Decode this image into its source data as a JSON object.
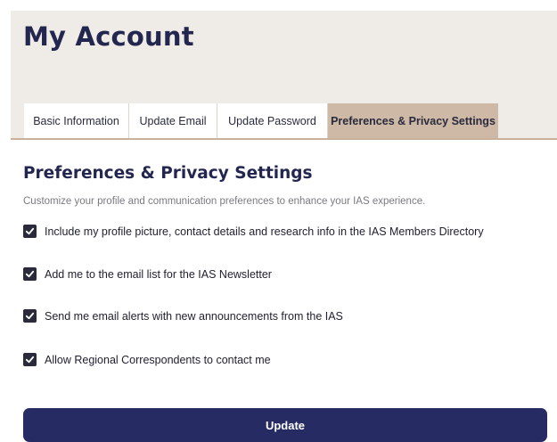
{
  "page": {
    "title": "My Account"
  },
  "tabs": [
    {
      "label": "Basic Information",
      "active": false
    },
    {
      "label": "Update Email",
      "active": false
    },
    {
      "label": "Update Password",
      "active": false
    },
    {
      "label": "Preferences & Privacy Settings",
      "active": true
    }
  ],
  "section": {
    "title": "Preferences & Privacy Settings",
    "description": "Customize your profile and communication preferences to enhance your IAS experience."
  },
  "options": [
    {
      "label": "Include my profile picture, contact details and research info in the IAS Members Directory",
      "checked": true
    },
    {
      "label": "Add me to the email list for the IAS Newsletter",
      "checked": true
    },
    {
      "label": "Send me email alerts with new announcements from the IAS",
      "checked": true
    },
    {
      "label": "Allow Regional Correspondents to contact me",
      "checked": true
    }
  ],
  "actions": {
    "update_label": "Update"
  },
  "colors": {
    "header_bg": "#efebe6",
    "active_tab_bg": "#cdb9a5",
    "primary": "#262c63",
    "title": "#23264f",
    "checkbox": "#2a2a3a"
  },
  "icons": {
    "checkbox": "checkmark-icon"
  }
}
